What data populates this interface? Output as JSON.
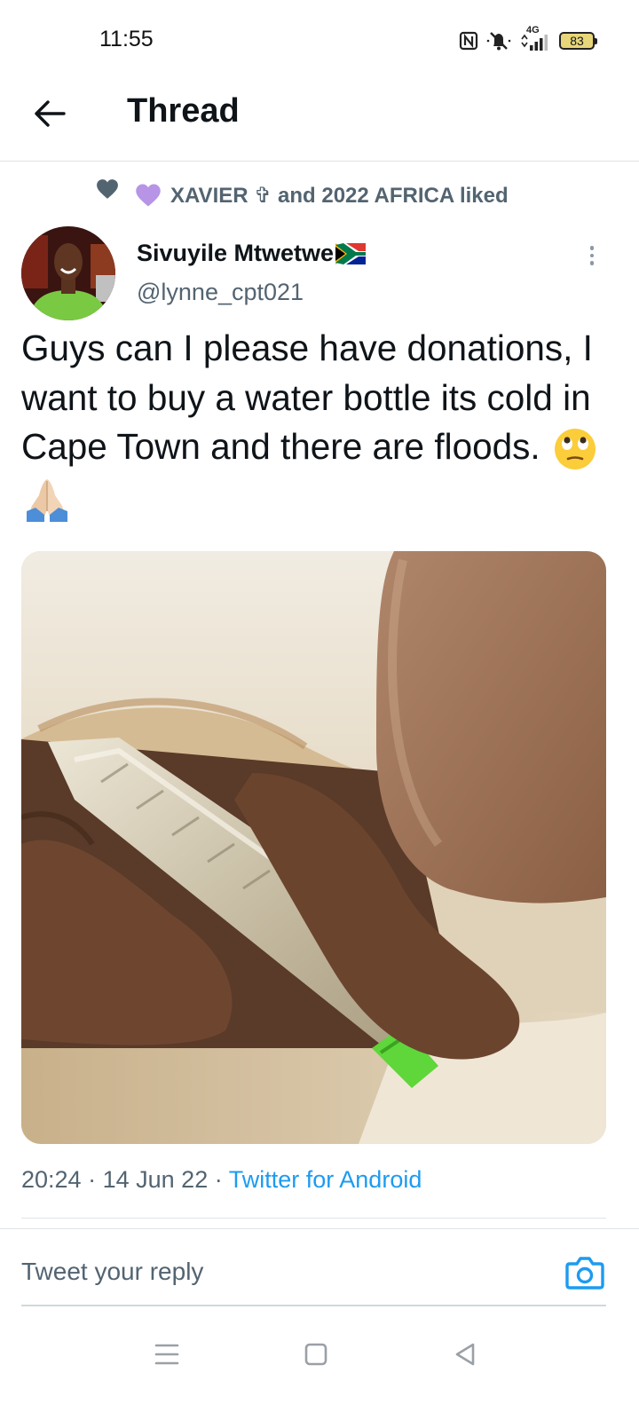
{
  "status_bar": {
    "time": "11:55",
    "network": "4G",
    "battery": "83",
    "icons": [
      "nfc-icon",
      "mute-icon",
      "signal-icon",
      "battery-icon"
    ]
  },
  "header": {
    "title": "Thread",
    "back_icon": "arrow-left-icon"
  },
  "social_context": {
    "text": "XAVIER ✞ and 2022 AFRICA liked",
    "icons": [
      "heart-icon",
      "purple-heart-emoji"
    ],
    "colors": {
      "heart": "#536471",
      "purple_heart": "#b794e6"
    }
  },
  "tweet": {
    "author_name": "Sivuyile Mtwetwe",
    "author_flag": "south-africa-flag",
    "handle": "@lynne_cpt021",
    "text": "Guys can I please have donations, I want to buy a water bottle its cold in Cape Town and there are floods.",
    "emojis": [
      "face-with-rolling-eyes-emoji",
      "folded-hands-emoji"
    ],
    "time": "20:24",
    "separator": "·",
    "date": "14 Jun 22",
    "source": "Twitter for Android"
  },
  "reply": {
    "placeholder": "Tweet your reply",
    "camera_icon": "camera-icon"
  },
  "nav": {
    "icons": [
      "menu-icon",
      "home-square-icon",
      "back-triangle-icon"
    ]
  },
  "colors": {
    "accent": "#1d9bf0",
    "text_primary": "#0f1419",
    "text_secondary": "#536471",
    "divider": "#dfe4e8"
  }
}
